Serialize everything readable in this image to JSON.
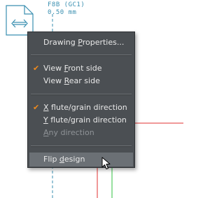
{
  "canvas": {
    "board_name": "F8B (GC1)",
    "board_thickness": "0.50 mm",
    "flip_icon": "flip-horizontal-icon"
  },
  "menu": {
    "items": [
      {
        "pre": "Drawing ",
        "ul": "P",
        "post": "roperties...",
        "checked": false,
        "disabled": false
      },
      {
        "pre": "View ",
        "ul": "F",
        "post": "ront side",
        "checked": true,
        "disabled": false
      },
      {
        "pre": "View ",
        "ul": "R",
        "post": "ear side",
        "checked": false,
        "disabled": false
      },
      {
        "pre": "",
        "ul": "X",
        "post": " flute/grain direction",
        "checked": true,
        "disabled": false
      },
      {
        "pre": "",
        "ul": "Y",
        "post": " flute/grain direction",
        "checked": false,
        "disabled": false
      },
      {
        "pre": "",
        "ul": "A",
        "post": "ny direction",
        "checked": false,
        "disabled": true
      },
      {
        "pre": "Flip ",
        "ul": "d",
        "post": "esign",
        "checked": false,
        "disabled": false,
        "hover": true
      }
    ],
    "check_glyph": "✔"
  },
  "colors": {
    "menu_bg": "#4b4f53",
    "menu_hover": "#6b7075",
    "check": "#f08a1c",
    "dashed_line": "#3a8fb0",
    "red_line": "#e03030",
    "green_line": "#30c040"
  }
}
